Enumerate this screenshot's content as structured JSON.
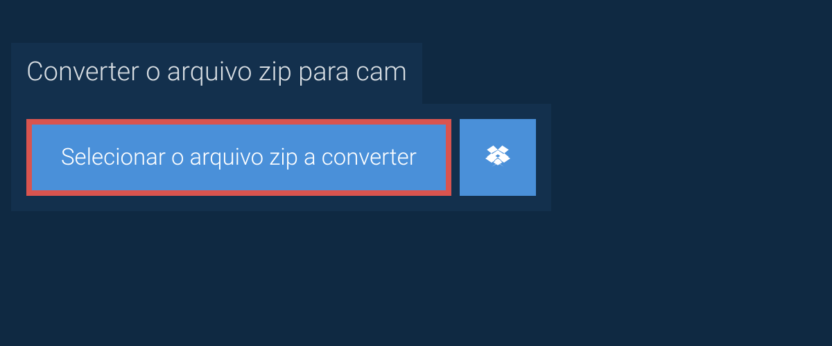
{
  "header": {
    "title": "Converter o arquivo zip para cam"
  },
  "actions": {
    "select_file_label": "Selecionar o arquivo zip a converter"
  },
  "colors": {
    "page_bg": "#0f2942",
    "panel_bg": "#13304d",
    "button_bg": "#4a90d9",
    "highlight_border": "#d9544f",
    "text": "#ffffff"
  }
}
